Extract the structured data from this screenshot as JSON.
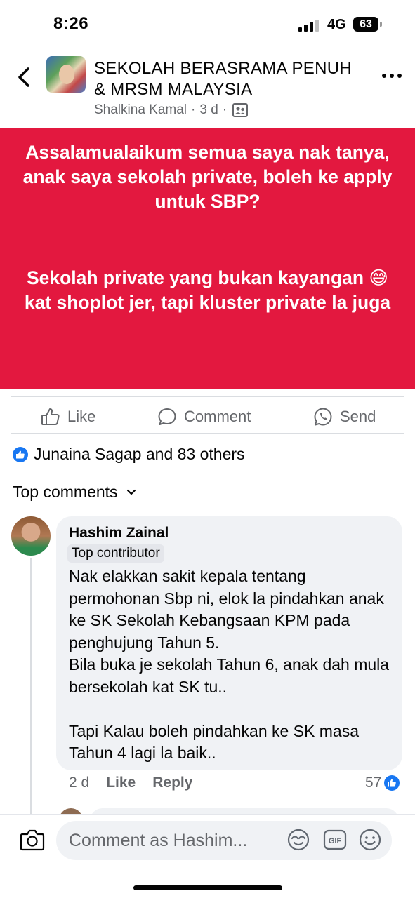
{
  "status_bar": {
    "time": "8:26",
    "network": "4G",
    "battery": "63"
  },
  "header": {
    "group_name": "SEKOLAH BERASRAMA PENUH & MRSM MALAYSIA",
    "author": "Shalkina Kamal",
    "time_ago": "3 d",
    "separator": "·"
  },
  "post": {
    "paragraph1": "Assalamualaikum semua saya nak tanya, anak saya sekolah private, boleh ke apply untuk SBP?",
    "paragraph2": "Sekolah private yang bukan kayangan 😅 kat shoplot jer, tapi kluster private la juga",
    "background_color": "#e3183f"
  },
  "actions": {
    "like": "Like",
    "comment": "Comment",
    "send": "Send"
  },
  "reactions": {
    "summary": "Junaina Sagap and 83 others"
  },
  "comments_header": {
    "label": "Top comments"
  },
  "comment": {
    "author": "Hashim Zainal",
    "badge": "Top contributor",
    "text": "Nak elakkan sakit kepala tentang permohonan Sbp ni, elok la pindahkan anak ke SK Sekolah Kebangsaan KPM pada penghujung Tahun 5.\nBila buka je sekolah Tahun 6, anak dah mula bersekolah kat SK tu..\n\nTapi Kalau boleh pindahkan ke SK masa Tahun 4 lagi la baik..",
    "time_ago": "2 d",
    "like_label": "Like",
    "reply_label": "Reply",
    "like_count": "57"
  },
  "composer": {
    "placeholder": "Comment as Hashim..."
  },
  "colors": {
    "accent": "#1877f2",
    "secondary_text": "#65676b"
  }
}
